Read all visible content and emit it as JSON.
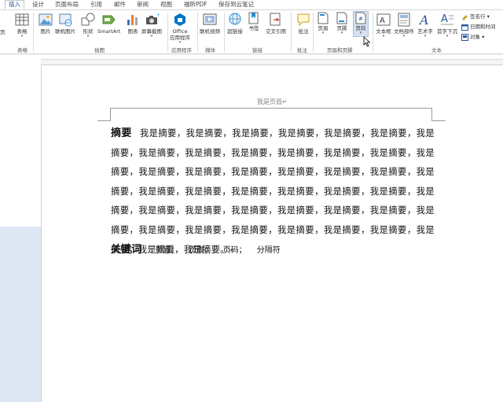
{
  "tabs": [
    "插入",
    "设计",
    "页面布局",
    "引用",
    "邮件",
    "审阅",
    "视图",
    "福昕PDF",
    "保存到云笔记"
  ],
  "ribbon": {
    "page_partial": "页",
    "table": "表格",
    "pictures": "图片",
    "online_pictures": "联机图片",
    "shapes": "形状",
    "smartart": "SmartArt",
    "chart": "图表",
    "screenshot": "屏幕截图",
    "office_apps_1": "Office",
    "office_apps_2": "应用程序",
    "online_video": "联机视频",
    "hyperlink": "超链接",
    "bookmark": "书签",
    "cross_reference": "交叉引用",
    "comment": "批注",
    "header": "页眉",
    "footer": "页脚",
    "page_number": "页码",
    "text_box": "文本框",
    "quick_parts": "文档部件",
    "wordart": "艺术字",
    "drop_cap": "首字下沉",
    "signature_line": "签名行",
    "date_time": "日期和时间",
    "object": "对象",
    "groups": {
      "tables": "表格",
      "illustrations": "插图",
      "apps": "应用程序",
      "media": "媒体",
      "links": "链接",
      "comments": "批注",
      "header_footer": "页眉和页脚",
      "text": "文本"
    }
  },
  "document": {
    "header_text": "我是页眉",
    "abstract_title": "摘要",
    "abstract_body": "我是摘要，我是摘要，我是摘要，我是摘要，我是摘要，我是摘要，我是摘要，我是摘要，我是摘要，我是摘要，我是摘要，我是摘要，我是摘要，我是摘要，我是摘要，我是摘要，我是摘要，我是摘要，我是摘要，我是摘要，我是摘要，我是摘要，我是摘要，我是摘要，我是摘要，我是摘要，我是摘要，我是摘要，我是摘要，我是摘要，我是摘要，我是摘要，我是摘要，我是摘要，我是摘要，我是摘要，我是摘要，我是摘要，我是摘要，我是摘要，我是摘要，我是摘要，我是摘要，我是摘要。",
    "keywords_title": "关键词",
    "keywords": [
      "页眉；",
      "页脚；",
      "页码；",
      "分隔符"
    ]
  },
  "colors": {
    "accent": "#2b579a",
    "hover": "#d5e1f2"
  }
}
